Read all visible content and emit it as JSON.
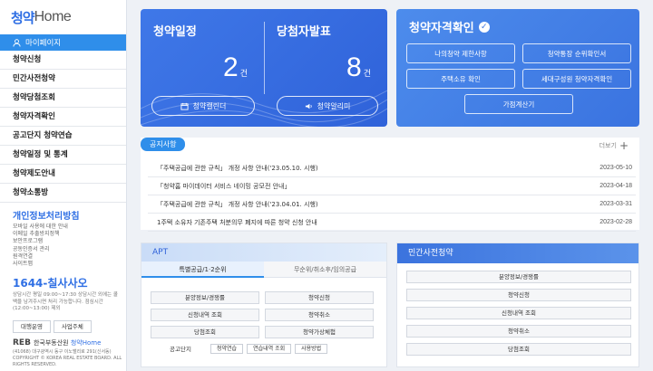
{
  "sidebar": {
    "logo_mark": "청약",
    "logo_text": "Home",
    "mypage": "마이페이지",
    "items": [
      "청약신청",
      "민간사전청약",
      "청약당첨조회",
      "청약자격확인",
      "공고단지 청약연습",
      "청약일정 및 통계",
      "청약제도안내",
      "청약소통방"
    ],
    "privacy_title": "개인정보처리방침",
    "privacy_links": [
      "모바일 사용에 대한 안내",
      "이메일 추출방지정책",
      "보안프로그램",
      "공동인증서 관리",
      "원격연결",
      "사이트맵"
    ],
    "call_number": "1644-칠사사오",
    "call_hours": "상담시간 평일 09:00~17:30 상담시간 외에는 콜백을 남겨주시면 처리 가능합니다. 점심시간(12:00~13:00) 제외",
    "btn_daebeop": "대행운영",
    "btn_business": "사업주체",
    "brand_reb": "REB",
    "brand_name": "한국부동산원",
    "brand_cheongyak": "청약Home",
    "footer_small": "(41068) 대구광역시 동구 이노밸리로 291(신서동) COPYRIGHT © KOREA REAL ESTATE BOARD. ALL RIGHTS RESERVED."
  },
  "summary": {
    "schedule_title": "청약일정",
    "schedule_count": "2",
    "schedule_unit": "건",
    "winners_title": "당첨자발표",
    "winners_count": "8",
    "winners_unit": "건",
    "calendar_btn": "청약캘린더",
    "alarm_btn": "청약알리미"
  },
  "qualify": {
    "title": "청약자격확인",
    "buttons": [
      "나의청약 제한사항",
      "청약통장 순위확인서",
      "주택소유 확인",
      "세대구성원 청약자격확인"
    ],
    "center_button": "가점계산기"
  },
  "notice": {
    "tag": "공지사항",
    "more": "더보기",
    "rows": [
      {
        "title": "「주택공급에 관한 규칙」 개정 사항 안내('23.05.10. 시행)",
        "date": "2023-05-10"
      },
      {
        "title": "「청약홈 마이데이터 서비스 네이밍 공모전 안내」",
        "date": "2023-04-18"
      },
      {
        "title": "「주택공급에 관한 규칙」 개정 사항 안내('23.04.01. 시행)",
        "date": "2023-03-31"
      },
      {
        "title": "1주택 소유자 기존주택 처분의무 폐지에 따른 청약 신청 안내",
        "date": "2023-02-28"
      }
    ]
  },
  "apt": {
    "title": "APT",
    "tab_active": "특별공급/1·2순위",
    "tab_other": "무순위/취소후/임의공급",
    "buttons": [
      "분양정보/경쟁률",
      "청약신청",
      "신청내역 조회",
      "청약취소",
      "당첨조회",
      "청약가상체험"
    ],
    "row_label": "공고단지",
    "row_buttons": [
      "청약연습",
      "연습내역 조회",
      "사용방법"
    ]
  },
  "private": {
    "title": "민간사전청약",
    "buttons": [
      "분양정보/경쟁률",
      "청약신청",
      "신청내역 조회",
      "청약취소",
      "당첨조회"
    ]
  },
  "colors": {
    "primary": "#2f62d9",
    "accent": "#2f8eea"
  }
}
